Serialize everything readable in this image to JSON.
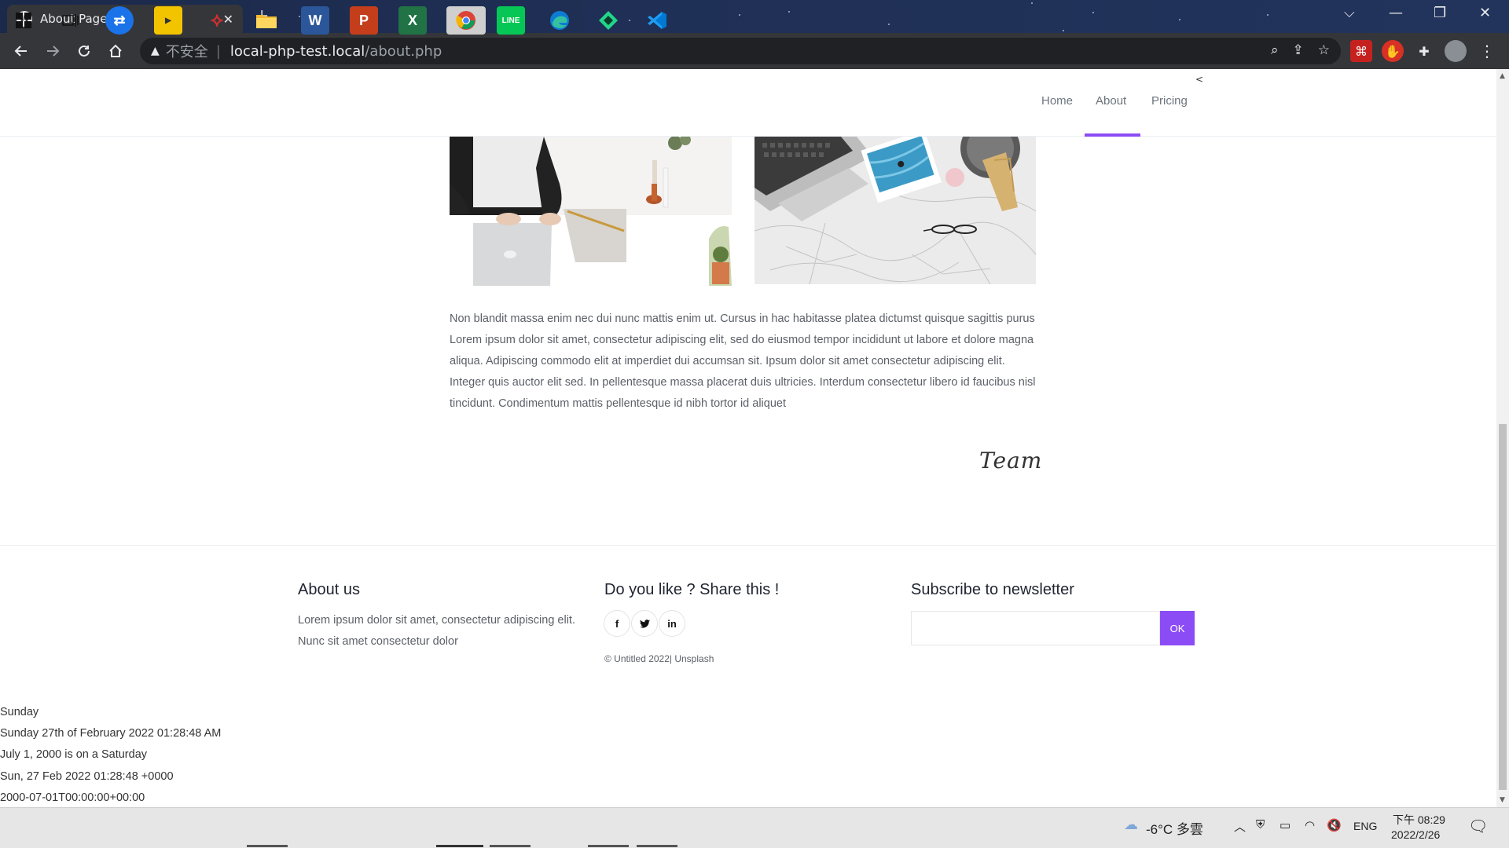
{
  "browser": {
    "tab_title": "About Page",
    "tab_close": "✕",
    "new_tab": "+",
    "security_label": "不安全",
    "url_host": "local-php-test.local",
    "url_path": "/about.php",
    "window_controls": {
      "tab_search": "⌵",
      "minimize": "—",
      "restore": "❐",
      "close": "✕"
    }
  },
  "site": {
    "nav": {
      "items": [
        {
          "label": "Home"
        },
        {
          "label": "About",
          "active": true
        },
        {
          "label": "Pricing"
        }
      ],
      "toggle": "<",
      "accent_color": "#8c4cf5"
    },
    "body_paragraph": "Non blandit massa enim nec dui nunc mattis enim ut. Cursus in hac habitasse platea dictumst quisque sagittis purus Lorem ipsum dolor sit amet, consectetur adipiscing elit, sed do eiusmod tempor incididunt ut labore et dolore magna aliqua. Adipiscing commodo elit at imperdiet dui accumsan sit. Ipsum dolor sit amet consectetur adipiscing elit. Integer quis auctor elit sed. In pellentesque massa placerat duis ultricies. Interdum consectetur libero id faucibus nisl tincidunt. Condimentum mattis pellentesque id nibh tortor id aliquet",
    "signature": "Team",
    "footer": {
      "about_heading": "About us",
      "about_text": "Lorem ipsum dolor sit amet, consectetur adipiscing elit. Nunc sit amet consectetur dolor",
      "share_heading": "Do you like ? Share this !",
      "social": [
        {
          "icon": "facebook-icon",
          "glyph": "f"
        },
        {
          "icon": "twitter-icon",
          "glyph": "🐦"
        },
        {
          "icon": "linkedin-icon",
          "glyph": "in"
        }
      ],
      "copyright": "© Untitled 2022| Unsplash",
      "newsletter_heading": "Subscribe to newsletter",
      "newsletter_button": "OK"
    },
    "php_dates": [
      "Sunday",
      "Sunday 27th of February 2022 01:28:48 AM",
      "July 1, 2000 is on a Saturday",
      "Sun, 27 Feb 2022 01:28:48 +0000",
      "2000-07-01T00:00:00+00:00"
    ]
  },
  "taskbar": {
    "weather": "-6°C 多雲",
    "language": "ENG",
    "time": "下午 08:29",
    "date": "2022/2/26"
  }
}
